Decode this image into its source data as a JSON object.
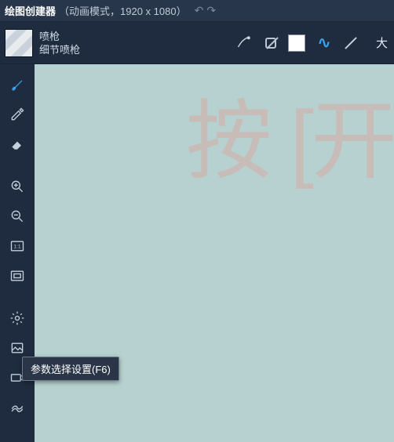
{
  "title": {
    "main": "绘图创建器",
    "sub": "（动画模式，1920 x 1080）"
  },
  "history": {
    "undo": "↶",
    "redo": "↷"
  },
  "brush": {
    "name": "喷枪",
    "preset": "细节喷枪"
  },
  "right": {
    "big": "大"
  },
  "watermark": "按 [开",
  "tooltip": "参数选择设置(F6)",
  "side": {
    "brush": "brush-tool",
    "picker": "eyedropper-tool",
    "eraser": "eraser-tool",
    "zoomin": "zoom-in",
    "zoomout": "zoom-out",
    "actual": "1:1",
    "fit": "fit-screen",
    "settings": "settings",
    "image": "image-layer",
    "camera": "camera",
    "fx": "fx"
  }
}
